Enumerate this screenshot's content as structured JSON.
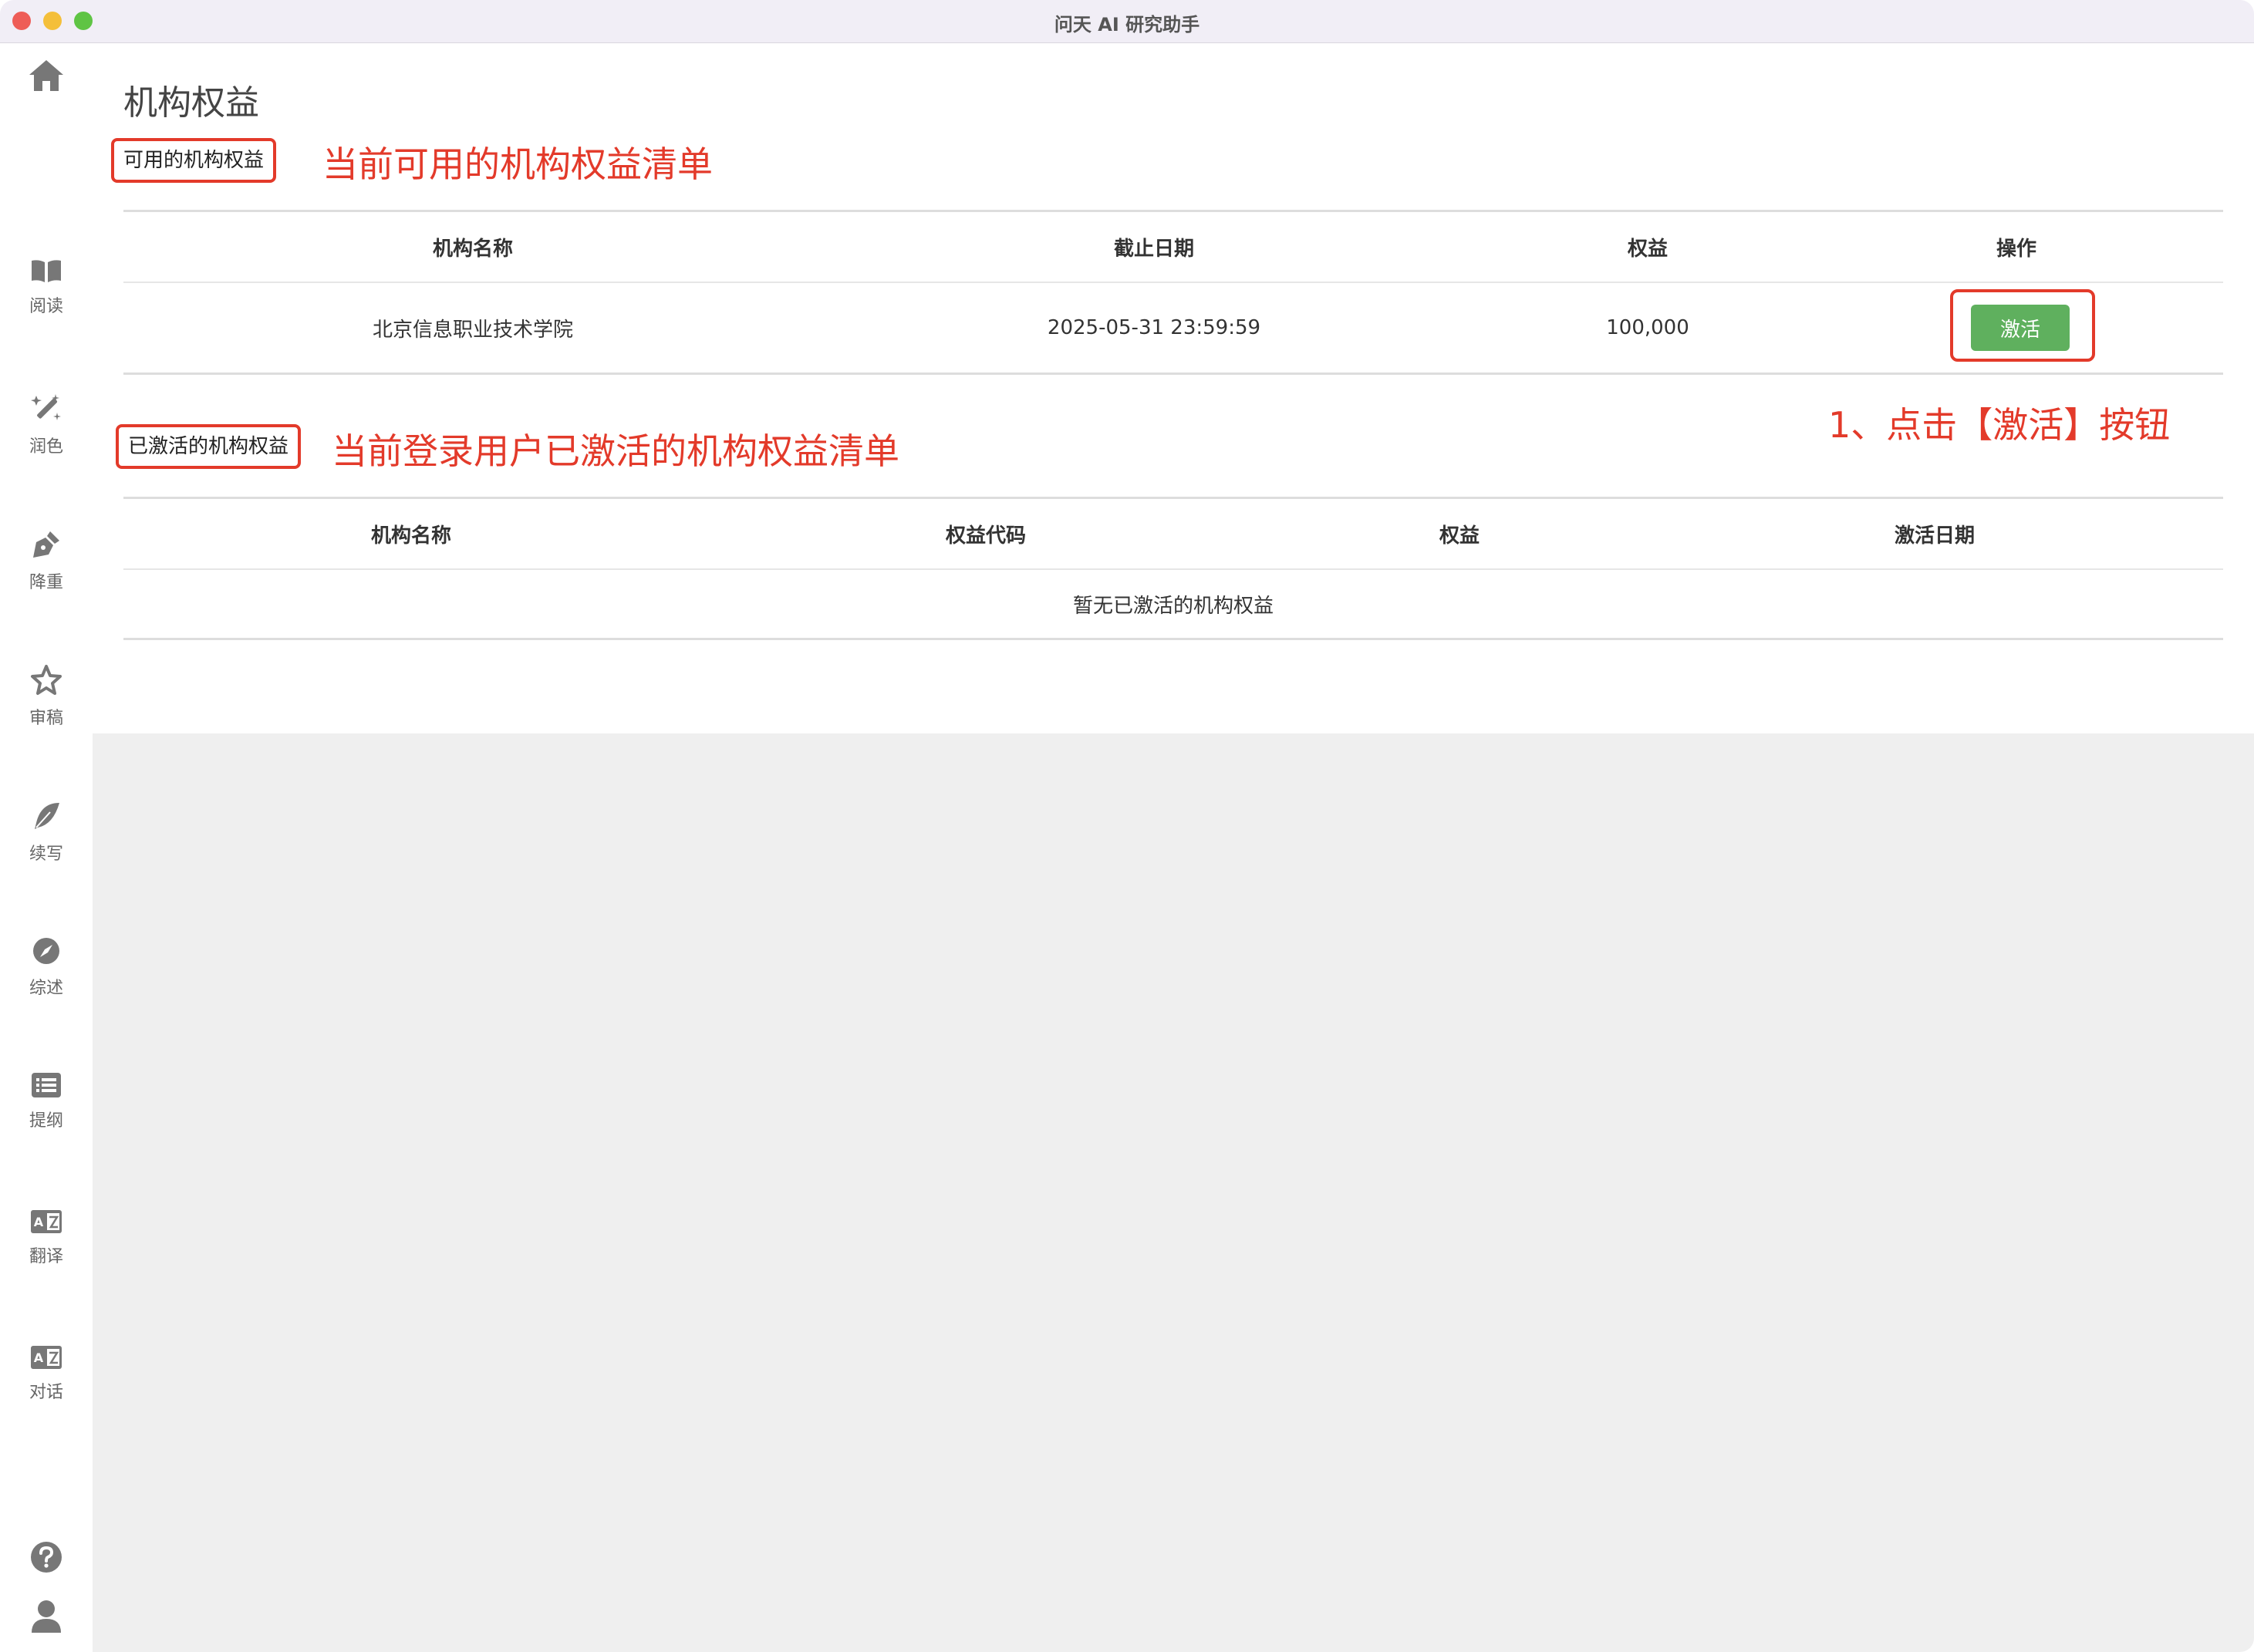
{
  "window": {
    "title": "问天 AI 研究助手"
  },
  "sidebar": {
    "items": [
      {
        "icon": "home-icon",
        "label": ""
      },
      {
        "icon": "book-icon",
        "label": "阅读"
      },
      {
        "icon": "magic-wand-icon",
        "label": "润色"
      },
      {
        "icon": "pen-nib-icon",
        "label": "降重"
      },
      {
        "icon": "star-icon",
        "label": "审稿"
      },
      {
        "icon": "feather-icon",
        "label": "续写"
      },
      {
        "icon": "compass-icon",
        "label": "综述"
      },
      {
        "icon": "list-icon",
        "label": "提纲"
      },
      {
        "icon": "translate-icon",
        "label": "翻译"
      },
      {
        "icon": "translate-icon",
        "label": "对话"
      }
    ],
    "bottom": [
      {
        "icon": "question-icon"
      },
      {
        "icon": "user-icon"
      }
    ]
  },
  "page": {
    "title": "机构权益"
  },
  "available": {
    "label": "可用的机构权益",
    "annotation": "当前可用的机构权益清单",
    "columns": [
      "机构名称",
      "截止日期",
      "权益",
      "操作"
    ],
    "rows": [
      {
        "name": "北京信息职业技术学院",
        "deadline": "2025-05-31 23:59:59",
        "quota": "100,000",
        "action": "激活"
      }
    ]
  },
  "activated": {
    "label": "已激活的机构权益",
    "annotation": "当前登录用户已激活的机构权益清单",
    "columns": [
      "机构名称",
      "权益代码",
      "权益",
      "激活日期"
    ],
    "empty_text": "暂无已激活的机构权益"
  },
  "step_annotation": "1、点击【激活】按钮",
  "colors": {
    "accent_red": "#e33a2a",
    "activate_green": "#5fb05e",
    "titlebar": "#f1eef6",
    "grey_area": "#efefef"
  }
}
